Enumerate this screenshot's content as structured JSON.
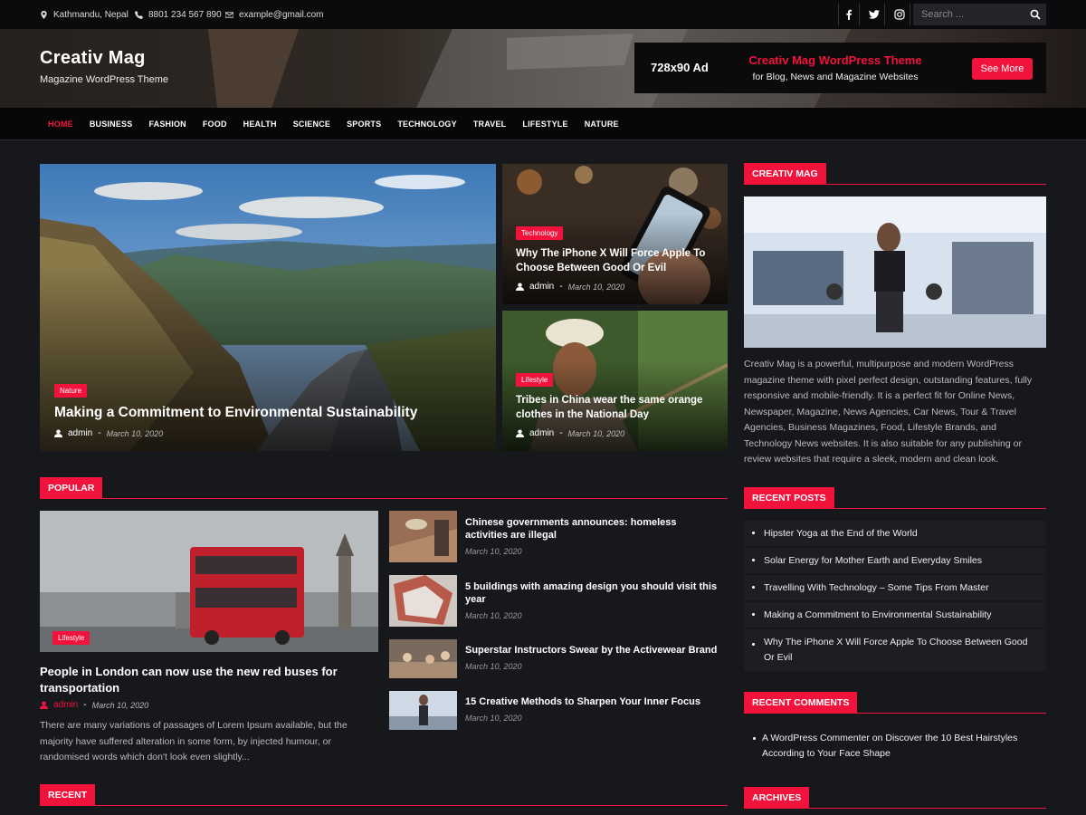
{
  "topbar": {
    "location": "Kathmandu, Nepal",
    "phone": "8801 234 567 890",
    "email": "example@gmail.com",
    "social": [
      "facebook-icon",
      "twitter-icon",
      "instagram-icon"
    ],
    "search_placeholder": "Search ..."
  },
  "site": {
    "title": "Creativ Mag",
    "tagline": "Magazine WordPress Theme"
  },
  "ad": {
    "label": "728x90 Ad",
    "headline": "Creativ Mag WordPress Theme",
    "subline": "for Blog, News and Magazine Websites",
    "button": "See More"
  },
  "nav": [
    "HOME",
    "BUSINESS",
    "FASHION",
    "FOOD",
    "HEALTH",
    "SCIENCE",
    "SPORTS",
    "TECHNOLOGY",
    "TRAVEL",
    "LIFESTYLE",
    "NATURE"
  ],
  "featured": {
    "main": {
      "tag": "Nature",
      "title": "Making a Commitment to Environmental Sustainability",
      "author": "admin",
      "date": "March 10, 2020"
    },
    "side1": {
      "tag": "Technology",
      "title": "Why The iPhone X Will Force Apple To Choose Between Good Or Evil",
      "author": "admin",
      "date": "March 10, 2020"
    },
    "side2": {
      "tag": "Lifestyle",
      "title": "Tribes in China wear the same orange clothes in the National Day",
      "author": "admin",
      "date": "March 10, 2020"
    }
  },
  "popular": {
    "heading": "POPULAR",
    "main": {
      "tag": "Lifestyle",
      "title": "People in London can now use the new red buses for transportation",
      "author": "admin",
      "date": "March 10, 2020",
      "excerpt": "There are many variations of passages of Lorem Ipsum available, but the majority have suffered alteration in some form, by injected humour, or randomised words which don't look even slightly..."
    },
    "list": [
      {
        "title": "Chinese governments announces: homeless activities are illegal",
        "date": "March 10, 2020"
      },
      {
        "title": "5 buildings with amazing design you should visit this year",
        "date": "March 10, 2020"
      },
      {
        "title": "Superstar Instructors Swear by the Activewear Brand",
        "date": "March 10, 2020"
      },
      {
        "title": "15 Creative Methods to Sharpen Your Inner Focus",
        "date": "March 10, 2020"
      }
    ]
  },
  "recent": {
    "heading": "RECENT"
  },
  "sidebar": {
    "about": {
      "heading": "CREATIV MAG",
      "text": "Creativ Mag is a powerful, multipurpose and modern WordPress magazine theme with pixel perfect design, outstanding features, fully responsive and mobile-friendly. It is a perfect fit for Online News, Newspaper, Magazine, News Agencies, Car News, Tour & Travel Agencies, Business Magazines, Food, Lifestyle Brands, and Technology News websites. It is also suitable for any publishing or review websites that require a sleek, modern and clean look."
    },
    "recent_posts": {
      "heading": "RECENT POSTS",
      "items": [
        "Hipster Yoga at the End of the World",
        "Solar Energy for Mother Earth and Everyday Smiles",
        "Travelling With Technology – Some Tips From Master",
        "Making a Commitment to Environmental Sustainability",
        "Why The iPhone X Will Force Apple To Choose Between Good Or Evil"
      ]
    },
    "recent_comments": {
      "heading": "RECENT COMMENTS",
      "comment": {
        "author": "A WordPress Commenter",
        "on": "on",
        "post": "Discover the 10 Best Hairstyles According to Your Face Shape"
      }
    },
    "archives": {
      "heading": "ARCHIVES"
    }
  },
  "colors": {
    "accent": "#f2133c",
    "background": "#17181c",
    "topbar": "#0b0b0d"
  }
}
